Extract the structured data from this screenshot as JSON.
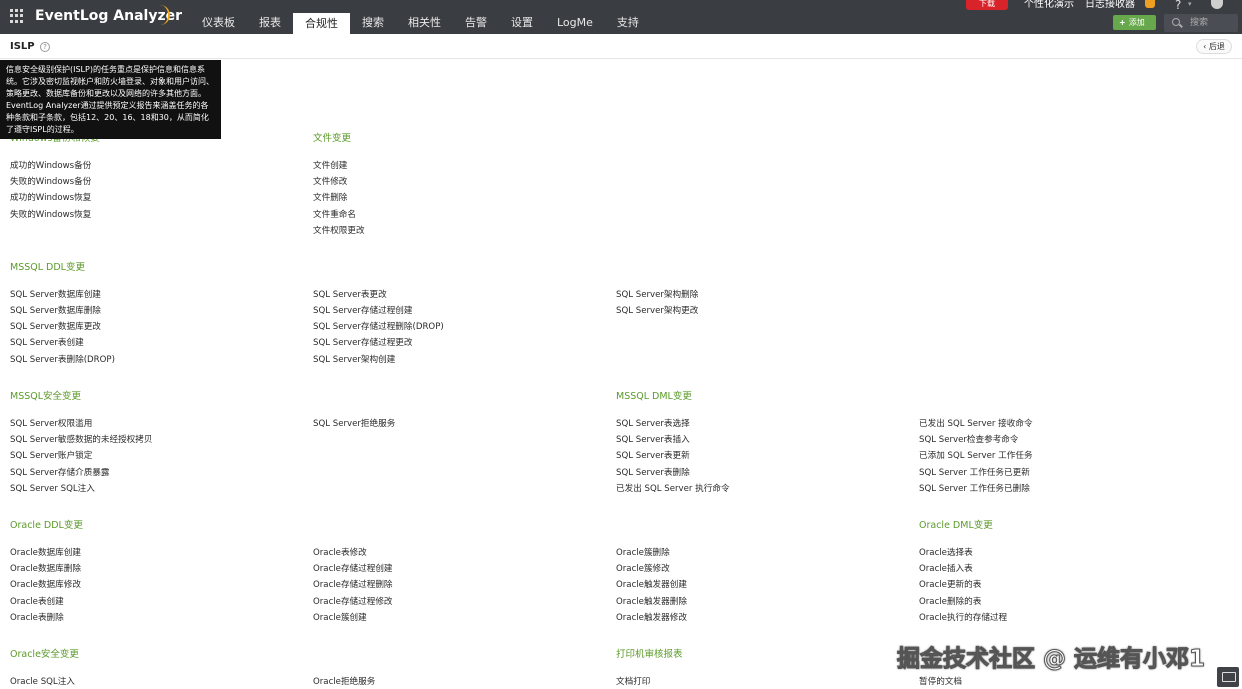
{
  "app": {
    "logo_text": "EventLog Analyzer",
    "nav_tabs": [
      "仪表板",
      "报表",
      "合规性",
      "搜索",
      "相关性",
      "告警",
      "设置",
      "LogMe",
      "支持"
    ],
    "active_tab": "合规性",
    "download_label": "下载",
    "personalize_label": "个性化演示",
    "log_receiver_label": "日志接收器",
    "add_label": "添加",
    "search_placeholder": "搜索",
    "help_symbol": "?"
  },
  "page": {
    "title": "ISLP",
    "back_label": "后退",
    "tooltip": "信息安全级别保护(ISLP)的任务重点是保护信息和信息系统。它涉及密切监视帐户和防火墙登录、对象和用户访问、策略更改、数据库备份和更改以及网络的许多其他方面。EventLog Analyzer通过提供预定义报告来涵盖任务的各种条款和子条款，包括12、20、16、18和30，从而简化了遵守ISPL的过程。"
  },
  "sections": [
    {
      "title": "Windows备份和恢复",
      "items": [
        "成功的Windows备份",
        "失败的Windows备份",
        "成功的Windows恢复",
        "失败的Windows恢复"
      ]
    },
    {
      "title": "文件变更",
      "items": [
        "文件创建",
        "文件修改",
        "文件删除",
        "文件重命名",
        "文件权限更改"
      ]
    },
    {
      "title": "MSSQL DDL变更",
      "items": [
        "SQL Server数据库创建",
        "SQL Server数据库删除",
        "SQL Server数据库更改",
        "SQL Server表创建",
        "SQL Server表删除(DROP)",
        "SQL Server表更改",
        "SQL Server存储过程创建",
        "SQL Server存储过程删除(DROP)",
        "SQL Server存储过程更改",
        "SQL Server架构创建",
        "SQL Server架构删除",
        "SQL Server架构更改"
      ]
    },
    {
      "title": "MSSQL安全变更",
      "items": [
        "SQL Server权限滥用",
        "SQL Server敏感数据的未经授权拷贝",
        "SQL Server账户锁定",
        "SQL Server存储介质暴露",
        "SQL Server SQL注入",
        "SQL Server拒绝服务"
      ]
    },
    {
      "title": "MSSQL DML变更",
      "items": [
        "SQL Server表选择",
        "SQL Server表插入",
        "SQL Server表更新",
        "SQL Server表删除",
        "已发出 SQL Server 执行命令",
        "已发出 SQL Server 接收命令",
        "SQL Server检查参考命令",
        "已添加 SQL Server 工作任务",
        "SQL Server 工作任务已更新",
        "SQL Server 工作任务已删除"
      ]
    },
    {
      "title": "Oracle DDL变更",
      "items": [
        "Oracle数据库创建",
        "Oracle数据库删除",
        "Oracle数据库修改",
        "Oracle表创建",
        "Oracle表删除",
        "Oracle表修改",
        "Oracle存储过程创建",
        "Oracle存储过程删除",
        "Oracle存储过程修改",
        "Oracle簇创建",
        "Oracle簇删除",
        "Oracle簇修改",
        "Oracle触发器创建",
        "Oracle触发器删除",
        "Oracle触发器修改"
      ]
    },
    {
      "title": "Oracle DML变更",
      "items": [
        "Oracle选择表",
        "Oracle插入表",
        "Oracle更新的表",
        "Oracle删除的表",
        "Oracle执行的存储过程"
      ]
    },
    {
      "title": "Oracle安全变更",
      "items": [
        "Oracle SQL注入",
        "Oracle拒绝服务"
      ]
    },
    {
      "title": "打印机审核报表",
      "items": [
        "文档打印",
        "暂停的文档"
      ]
    }
  ],
  "watermark": "掘金技术社区 @ 运维有小邓1"
}
